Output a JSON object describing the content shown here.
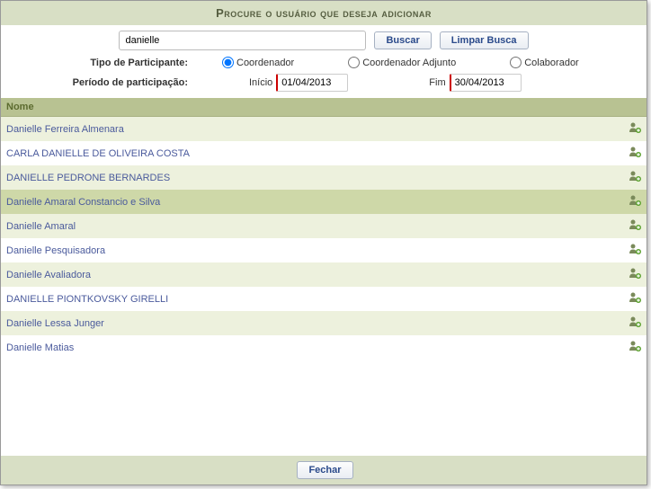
{
  "dialog": {
    "title": "Procure o usuário que deseja adicionar"
  },
  "search": {
    "value": "danielle",
    "buscar_label": "Buscar",
    "limpar_label": "Limpar Busca"
  },
  "participant_type": {
    "label": "Tipo de Participante:",
    "options": {
      "coordenador": "Coordenador",
      "coordenador_adjunto": "Coordenador Adjunto",
      "colaborador": "Colaborador"
    },
    "selected": "coordenador"
  },
  "period": {
    "label": "Período de participação:",
    "inicio_label": "Início",
    "inicio_value": "01/04/2013",
    "fim_label": "Fim",
    "fim_value": "30/04/2013"
  },
  "table": {
    "header_nome": "Nome",
    "rows": [
      {
        "name": "Danielle Ferreira Almenara",
        "highlight": false
      },
      {
        "name": "CARLA DANIELLE DE OLIVEIRA COSTA",
        "highlight": false
      },
      {
        "name": "DANIELLE PEDRONE BERNARDES",
        "highlight": false
      },
      {
        "name": "Danielle Amaral Constancio e Silva",
        "highlight": true
      },
      {
        "name": "Danielle Amaral",
        "highlight": false
      },
      {
        "name": "Danielle Pesquisadora",
        "highlight": false
      },
      {
        "name": "Danielle Avaliadora",
        "highlight": false
      },
      {
        "name": "DANIELLE PIONTKOVSKY GIRELLI",
        "highlight": false
      },
      {
        "name": "Danielle Lessa Junger",
        "highlight": false
      },
      {
        "name": "Danielle Matias",
        "highlight": false
      }
    ]
  },
  "footer": {
    "fechar_label": "Fechar"
  }
}
